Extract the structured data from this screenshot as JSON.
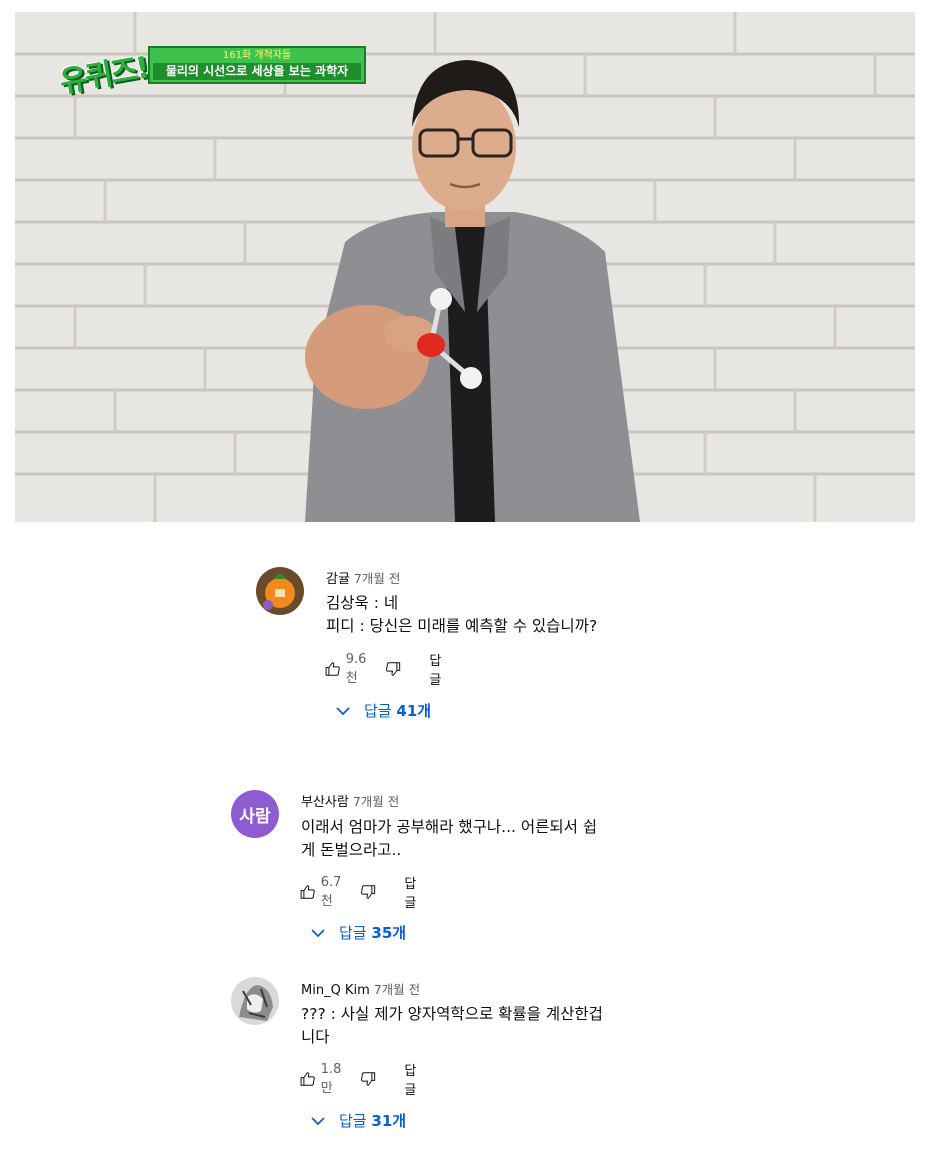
{
  "video": {
    "logo_text": "유퀴즈!",
    "caption_top": "161화 개척자들",
    "caption_main": "물리의 시선으로 세상을 보는 과학자"
  },
  "comments": [
    {
      "author": "감귤",
      "time": "7개월 전",
      "lines": [
        "김상욱 : 네",
        "피디 : 당신은 미래를 예측할 수 있습니까?"
      ],
      "likes": "9.6천",
      "reply_label": "답글",
      "replies_prefix": "답글",
      "replies_count": "41개",
      "avatar_icon": "tangerine-avatar-icon"
    },
    {
      "author": "부산사람",
      "time": "7개월 전",
      "avatar_text": "사람",
      "avatar_color": "#8e5bd0",
      "lines": [
        "이래서 엄마가 공부해라 했구나... 어른되서 쉽",
        "게 돈벌으라고.."
      ],
      "likes": "6.7천",
      "reply_label": "답글",
      "replies_prefix": "답글",
      "replies_count": "35개"
    },
    {
      "author": "Min_Q Kim",
      "time": "7개월 전",
      "lines": [
        "??? : 사실 제가 양자역학으로 확률을 계산한겁",
        "니다"
      ],
      "likes": "1.8만",
      "reply_label": "답글",
      "replies_prefix": "답글",
      "replies_count": "31개",
      "avatar_icon": "sketch-avatar-icon"
    }
  ],
  "colors": {
    "link": "#065fd4",
    "secondary_text": "#606060"
  }
}
